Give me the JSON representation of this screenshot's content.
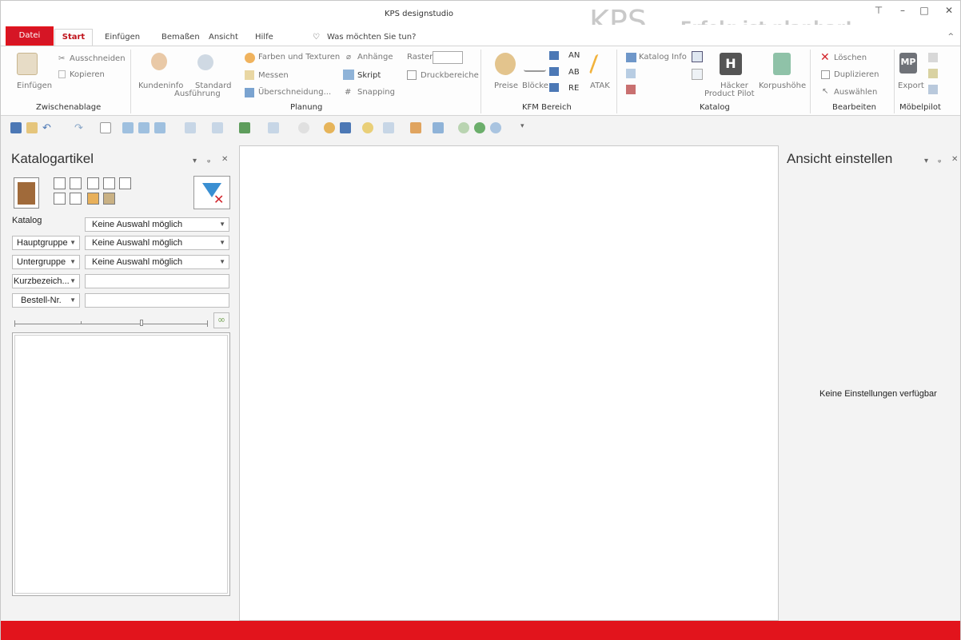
{
  "app": {
    "title": "KPS designstudio",
    "logo": "KPS",
    "logo_dot": ".",
    "slogan": "Erfolg ist planbar!",
    "window_controls": {
      "ribbon_display": "⊤",
      "minimize": "–",
      "maximize": "□",
      "close": "✕"
    }
  },
  "tabs": {
    "file": "Datei",
    "start": "Start",
    "items": [
      "Einfügen",
      "Bemaßen",
      "Ansicht",
      "Hilfe"
    ],
    "tell_me": "Was möchten Sie tun?"
  },
  "ribbon": {
    "zwischenablage": {
      "label": "Zwischenablage",
      "einfuegen": "Einfügen",
      "ausschneiden": "Ausschneiden",
      "kopieren": "Kopieren"
    },
    "planung": {
      "label": "Planung",
      "kundeninfo": "Kundeninfo",
      "standard": "Standard",
      "ausfuehrung": "Ausführung",
      "farben": "Farben und Texturen",
      "anhaenge": "Anhänge",
      "raster": "Raster",
      "messen": "Messen",
      "skript": "Skript",
      "druckbereiche": "Druckbereiche",
      "ueberschneidung": "Überschneidung...",
      "snapping": "Snapping"
    },
    "kfm": {
      "label": "KFM Bereich",
      "preise": "Preise",
      "bloecke": "Blöcke",
      "an": "AN",
      "ab": "AB",
      "re": "RE",
      "atak": "ATAK"
    },
    "katalog": {
      "label": "Katalog",
      "katalog_info": "Katalog Info",
      "haecker1": "Häcker",
      "haecker2": "Product Pilot",
      "korpushoehe": "Korpushöhe"
    },
    "bearbeiten": {
      "label": "Bearbeiten",
      "loeschen": "Löschen",
      "duplizieren": "Duplizieren",
      "auswaehlen": "Auswählen"
    },
    "moebelpilot": {
      "label": "Möbelpilot",
      "export": "Export"
    }
  },
  "left_panel": {
    "title": "Katalogartikel",
    "katalog_label": "Katalog",
    "katalog_value": "Keine Auswahl möglich",
    "hauptgruppe": "Hauptgruppe",
    "hauptgruppe_value": "Keine Auswahl möglich",
    "untergruppe": "Untergruppe",
    "untergruppe_value": "Keine Auswahl möglich",
    "kurzbezeichnung": "Kurzbezeich...",
    "kurz_value": "",
    "bestellnr": "Bestell-Nr.",
    "bestell_value": ""
  },
  "right_panel": {
    "title": "Ansicht einstellen",
    "empty_text": "Keine Einstellungen verfügbar"
  },
  "colors": {
    "accent": "#e2141c",
    "file_tab": "#d61525"
  }
}
